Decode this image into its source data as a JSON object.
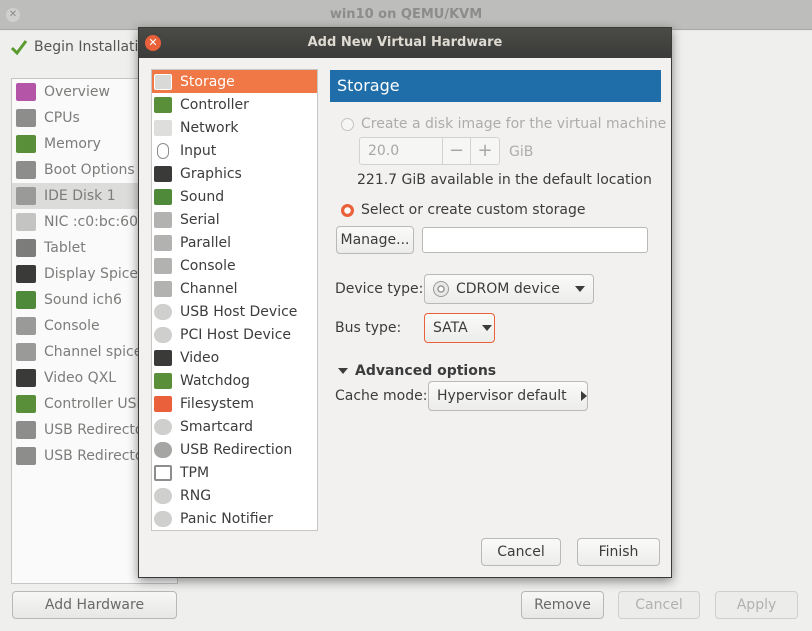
{
  "main_window": {
    "title": "win10 on QEMU/KVM",
    "begin_label": "Begin Installation",
    "sidebar": [
      {
        "label": "Overview",
        "icon": "monitor-icon",
        "color": "#b455a8"
      },
      {
        "label": "CPUs",
        "icon": "cpu-icon",
        "color": "#8d8d8b"
      },
      {
        "label": "Memory",
        "icon": "memory-icon",
        "color": "#5a8f3a"
      },
      {
        "label": "Boot Options",
        "icon": "gear-icon",
        "color": "#8d8d8b"
      },
      {
        "label": "IDE Disk 1",
        "icon": "disk-icon",
        "color": "#9a9a98"
      },
      {
        "label": "NIC :c0:bc:60",
        "icon": "network-icon",
        "color": "#c4c4c2"
      },
      {
        "label": "Tablet",
        "icon": "tablet-icon",
        "color": "#7c7c7a"
      },
      {
        "label": "Display Spice",
        "icon": "display-icon",
        "color": "#3a3a38"
      },
      {
        "label": "Sound ich6",
        "icon": "sound-icon",
        "color": "#4e8a3a"
      },
      {
        "label": "Console",
        "icon": "console-icon",
        "color": "#9a9a98"
      },
      {
        "label": "Channel spice",
        "icon": "channel-icon",
        "color": "#9a9a98"
      },
      {
        "label": "Video QXL",
        "icon": "video-icon",
        "color": "#3a3a38"
      },
      {
        "label": "Controller USB",
        "icon": "controller-icon",
        "color": "#5a8f3a"
      },
      {
        "label": "USB Redirector",
        "icon": "usb-icon",
        "color": "#8d8d8b"
      },
      {
        "label": "USB Redirector",
        "icon": "usb-icon",
        "color": "#8d8d8b"
      }
    ],
    "add_hardware_label": "Add Hardware",
    "remove_label": "Remove",
    "cancel_label": "Cancel",
    "apply_label": "Apply"
  },
  "dialog": {
    "title": "Add New Virtual Hardware",
    "hardware_types": [
      {
        "label": "Storage",
        "icon": "storage-icon",
        "color": "#9a9a98"
      },
      {
        "label": "Controller",
        "icon": "controller-icon",
        "color": "#5a8f3a"
      },
      {
        "label": "Network",
        "icon": "network-icon",
        "color": "#c4c4c2"
      },
      {
        "label": "Input",
        "icon": "mouse-icon",
        "color": "#d7d7d5"
      },
      {
        "label": "Graphics",
        "icon": "monitor-icon",
        "color": "#3a3a38"
      },
      {
        "label": "Sound",
        "icon": "sound-icon",
        "color": "#4e8a3a"
      },
      {
        "label": "Serial",
        "icon": "serial-icon",
        "color": "#9a9a98"
      },
      {
        "label": "Parallel",
        "icon": "parallel-icon",
        "color": "#9a9a98"
      },
      {
        "label": "Console",
        "icon": "console-icon",
        "color": "#9a9a98"
      },
      {
        "label": "Channel",
        "icon": "channel-icon",
        "color": "#9a9a98"
      },
      {
        "label": "USB Host Device",
        "icon": "gear-icon",
        "color": "#b5b5b3"
      },
      {
        "label": "PCI Host Device",
        "icon": "gear-icon",
        "color": "#b5b5b3"
      },
      {
        "label": "Video",
        "icon": "video-icon",
        "color": "#3a3a38"
      },
      {
        "label": "Watchdog",
        "icon": "watchdog-icon",
        "color": "#5a8f3a"
      },
      {
        "label": "Filesystem",
        "icon": "folder-icon",
        "color": "#e9603a"
      },
      {
        "label": "Smartcard",
        "icon": "smartcard-icon",
        "color": "#b5b5b3"
      },
      {
        "label": "USB Redirection",
        "icon": "usb-icon",
        "color": "#8d8d8b"
      },
      {
        "label": "TPM",
        "icon": "chip-icon",
        "color": "#8d8d8b"
      },
      {
        "label": "RNG",
        "icon": "gear-icon",
        "color": "#b5b5b3"
      },
      {
        "label": "Panic Notifier",
        "icon": "gear-icon",
        "color": "#b5b5b3"
      }
    ],
    "section_title": "Storage",
    "create_disk_label": "Create a disk image for the virtual machine",
    "size_value": "20.0",
    "size_unit": "GiB",
    "minus": "−",
    "plus": "+",
    "available_text": "221.7 GiB available in the default location",
    "custom_storage_label": "Select or create custom storage",
    "manage_label": "Manage...",
    "storage_path_value": "",
    "device_type_label": "Device type:",
    "device_type_value": "CDROM device",
    "bus_type_label": "Bus type:",
    "bus_type_value": "SATA",
    "advanced_label": "Advanced options",
    "cache_mode_label": "Cache mode:",
    "cache_mode_value": "Hypervisor default",
    "cancel_label": "Cancel",
    "finish_label": "Finish"
  },
  "colors": {
    "accent": "#e9603a",
    "header_blue": "#1f6eaa",
    "selection": "#f07746",
    "dialog_titlebar": "#3b3b39"
  }
}
